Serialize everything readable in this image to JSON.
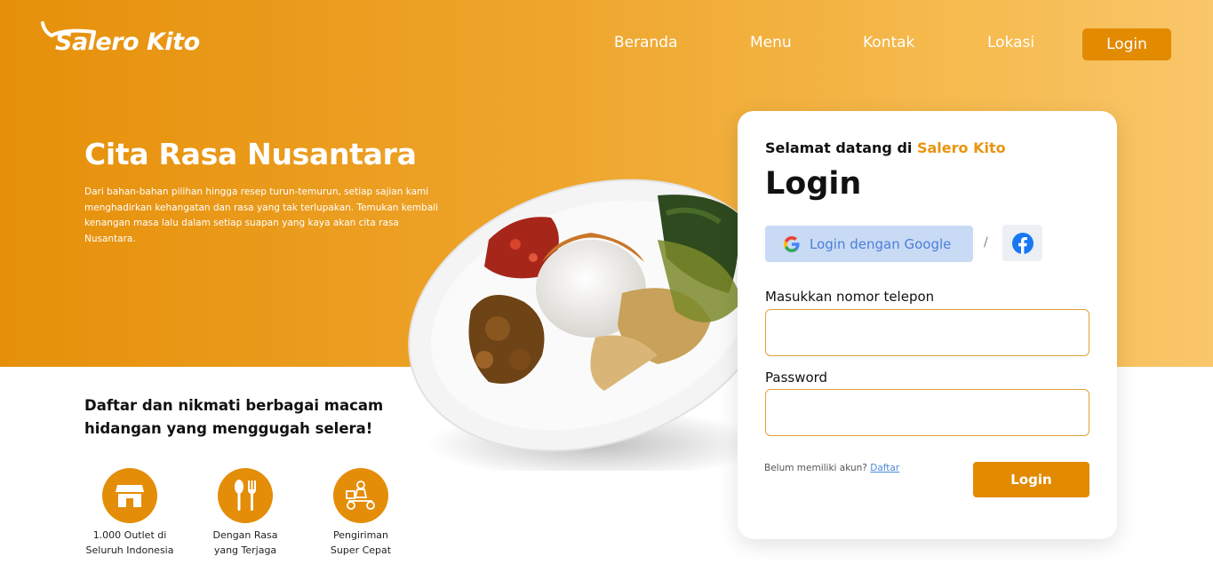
{
  "brand": {
    "name": "Salero Kito",
    "accent": "#e28a00"
  },
  "nav": {
    "items": [
      {
        "label": "Beranda"
      },
      {
        "label": "Menu"
      },
      {
        "label": "Kontak"
      },
      {
        "label": "Lokasi"
      }
    ],
    "login_label": "Login"
  },
  "hero": {
    "title": "Cita Rasa Nusantara",
    "description": "Dari bahan-bahan pilihan hingga resep turun-temurun, setiap sajian kami menghadirkan kehangatan dan rasa yang tak terlupakan. Temukan kembali kenangan masa lalu dalam setiap suapan yang kaya akan cita rasa Nusantara."
  },
  "promo": {
    "tagline": "Daftar dan nikmati berbagai macam hidangan yang menggugah selera!",
    "features": [
      {
        "icon": "store-icon",
        "line1": "1.000 Outlet di",
        "line2": "Seluruh Indonesia"
      },
      {
        "icon": "utensils-icon",
        "line1": "Dengan Rasa",
        "line2": "yang Terjaga"
      },
      {
        "icon": "delivery-scooter-icon",
        "line1": "Pengiriman",
        "line2": "Super Cepat"
      }
    ]
  },
  "login_card": {
    "welcome_prefix": "Selamat datang di",
    "welcome_brand": "Salero Kito",
    "title": "Login",
    "google_label": "Login dengan Google",
    "separator": "/",
    "facebook_icon": "facebook-icon",
    "phone_label": "Masukkan nomor telepon",
    "phone_value": "",
    "password_label": "Password",
    "password_value": "",
    "signup_prompt": "Belum memiliki akun?",
    "signup_link": "Daftar",
    "submit_label": "Login"
  }
}
